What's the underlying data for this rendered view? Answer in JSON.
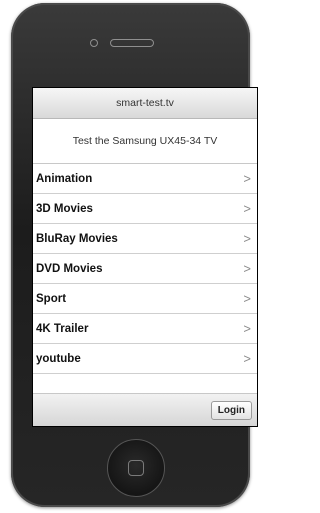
{
  "header": {
    "title": "smart-test.tv"
  },
  "subtitle": "Test the Samsung UX45-34 TV",
  "menu": {
    "items": [
      {
        "label": "Animation"
      },
      {
        "label": "3D Movies"
      },
      {
        "label": "BluRay Movies"
      },
      {
        "label": "DVD Movies"
      },
      {
        "label": "Sport"
      },
      {
        "label": "4K Trailer"
      },
      {
        "label": "youtube"
      }
    ],
    "chevron": ">"
  },
  "footer": {
    "login_label": "Login"
  }
}
